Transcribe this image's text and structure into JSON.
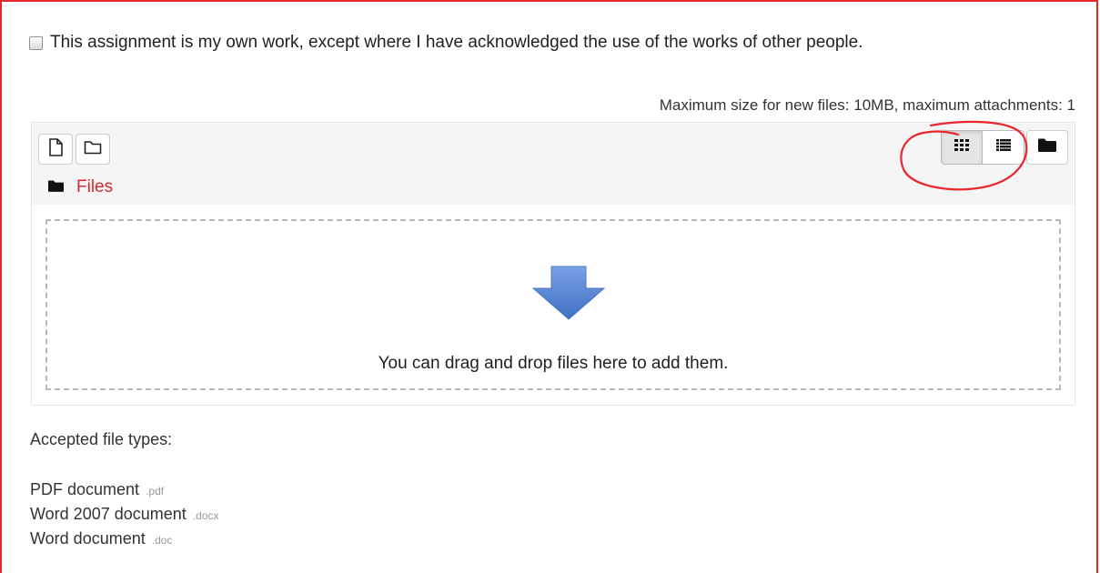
{
  "declaration": {
    "label": "This assignment is my own work, except where I have acknowledged the use of the works of other people.",
    "checked": false
  },
  "filemanager": {
    "max_size_text": "Maximum size for new files: 10MB, maximum attachments: 1",
    "toolbar": {
      "add_file_icon": "file-icon",
      "create_folder_icon": "folder-outline-icon",
      "view_icons_icon": "grid-icon",
      "view_list_icon": "list-icon",
      "view_tree_icon": "folder-icon",
      "active_view": "icons"
    },
    "path": {
      "label": "Files"
    },
    "drop_text": "You can drag and drop files here to add them."
  },
  "accepted": {
    "title": "Accepted file types:",
    "types": [
      {
        "name": "PDF document",
        "ext": ".pdf"
      },
      {
        "name": "Word 2007 document",
        "ext": ".docx"
      },
      {
        "name": "Word document",
        "ext": ".doc"
      }
    ]
  },
  "colors": {
    "annotation_red": "#e8262b",
    "path_link": "#d9292f",
    "arrow_blue": "#5b86cf"
  }
}
